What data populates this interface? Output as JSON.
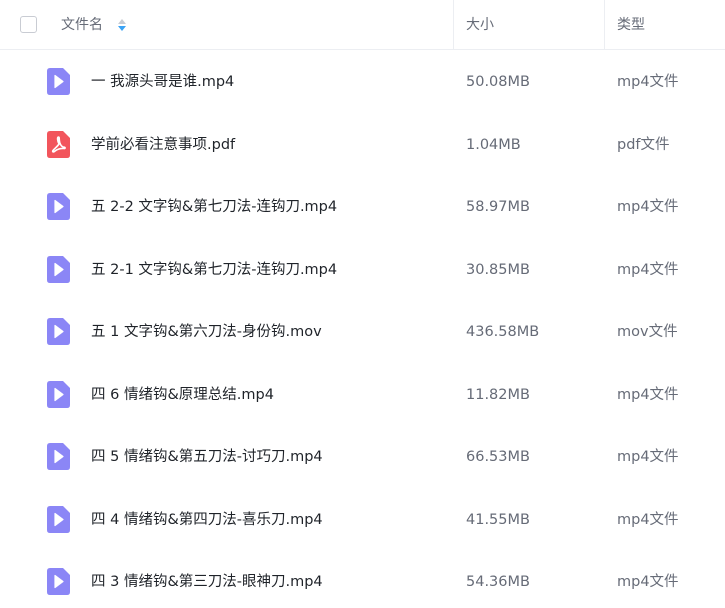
{
  "header": {
    "name_label": "文件名",
    "size_label": "大小",
    "type_label": "类型",
    "sort_icon": "sort-up-down-icon"
  },
  "colors": {
    "video_icon": "#8b86f6",
    "pdf_icon": "#f2555c",
    "sort_active": "#3aa3f5",
    "sort_inactive": "#c6cbd3"
  },
  "files": [
    {
      "name": "一 我源头哥是谁.mp4",
      "size": "50.08MB",
      "type": "mp4文件",
      "icon": "video-file-icon"
    },
    {
      "name": "学前必看注意事项.pdf",
      "size": "1.04MB",
      "type": "pdf文件",
      "icon": "pdf-file-icon"
    },
    {
      "name": "五 2-2 文字钩&第七刀法-连钩刀.mp4",
      "size": "58.97MB",
      "type": "mp4文件",
      "icon": "video-file-icon"
    },
    {
      "name": "五 2-1 文字钩&第七刀法-连钩刀.mp4",
      "size": "30.85MB",
      "type": "mp4文件",
      "icon": "video-file-icon"
    },
    {
      "name": "五 1 文字钩&第六刀法-身份钩.mov",
      "size": "436.58MB",
      "type": "mov文件",
      "icon": "video-file-icon"
    },
    {
      "name": "四 6 情绪钩&原理总结.mp4",
      "size": "11.82MB",
      "type": "mp4文件",
      "icon": "video-file-icon"
    },
    {
      "name": "四 5 情绪钩&第五刀法-讨巧刀.mp4",
      "size": "66.53MB",
      "type": "mp4文件",
      "icon": "video-file-icon"
    },
    {
      "name": "四 4 情绪钩&第四刀法-喜乐刀.mp4",
      "size": "41.55MB",
      "type": "mp4文件",
      "icon": "video-file-icon"
    },
    {
      "name": "四 3 情绪钩&第三刀法-眼神刀.mp4",
      "size": "54.36MB",
      "type": "mp4文件",
      "icon": "video-file-icon"
    }
  ]
}
